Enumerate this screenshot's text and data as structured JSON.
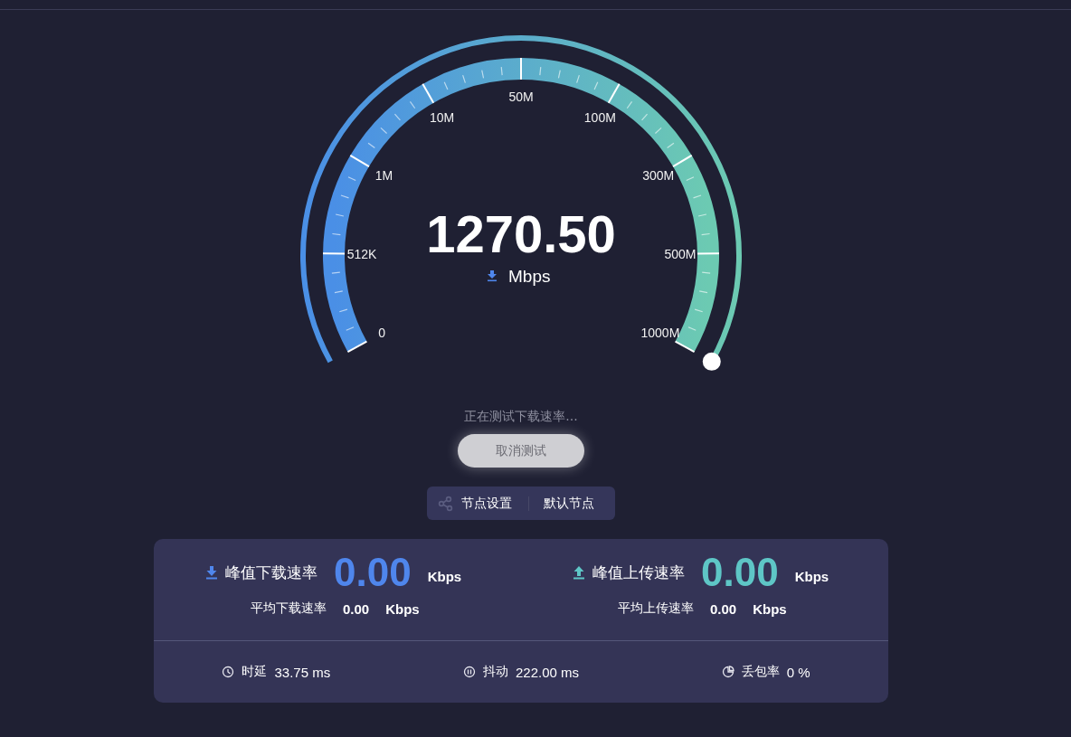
{
  "gauge": {
    "scale": [
      "0",
      "512K",
      "1M",
      "10M",
      "50M",
      "100M",
      "300M",
      "500M",
      "1000M"
    ],
    "value": "1270.50",
    "unit": "Mbps"
  },
  "status": "正在测试下载速率...",
  "cancel_button": "取消测试",
  "node": {
    "label": "节点设置",
    "value": "默认节点"
  },
  "peaks": [
    {
      "kind": "download",
      "label": "峰值下载速率",
      "value": "0.00",
      "unit": "Kbps",
      "avg_label": "平均下载速率",
      "avg_value": "0.00",
      "avg_unit": "Kbps"
    },
    {
      "kind": "upload",
      "label": "峰值上传速率",
      "value": "0.00",
      "unit": "Kbps",
      "avg_label": "平均上传速率",
      "avg_value": "0.00",
      "avg_unit": "Kbps"
    }
  ],
  "metrics": [
    {
      "kind": "latency",
      "label": "时延",
      "value": "33.75 ms"
    },
    {
      "kind": "jitter",
      "label": "抖动",
      "value": "222.00 ms"
    },
    {
      "kind": "loss",
      "label": "丢包率",
      "value": "0 %"
    }
  ]
}
